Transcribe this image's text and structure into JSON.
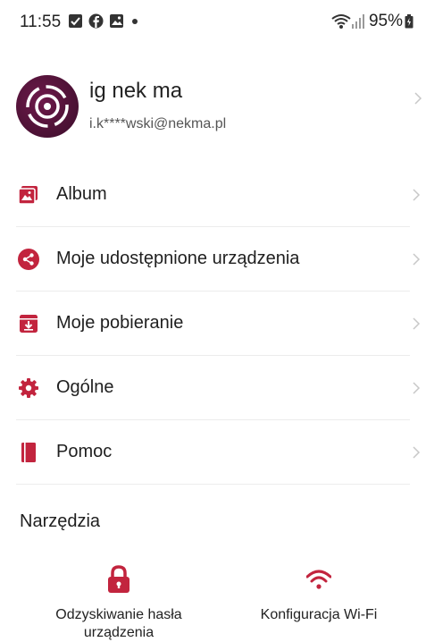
{
  "status_bar": {
    "time": "11:55",
    "battery": "95%"
  },
  "profile": {
    "name": "ig  nek ma",
    "email": "i.k****wski@nekma.pl"
  },
  "menu": [
    {
      "label": "Album",
      "icon": "album-icon"
    },
    {
      "label": "Moje udostępnione urządzenia",
      "icon": "share-icon"
    },
    {
      "label": "Moje pobieranie",
      "icon": "download-icon"
    },
    {
      "label": "Ogólne",
      "icon": "gear-icon"
    },
    {
      "label": "Pomoc",
      "icon": "book-icon"
    }
  ],
  "tools_section": {
    "title": "Narzędzia",
    "items": [
      {
        "label_line1": "Odzyskiwanie hasła",
        "label_line2": "urządzenia",
        "icon": "lock-icon"
      },
      {
        "label_line1": "Konfiguracja Wi-Fi",
        "label_line2": "",
        "icon": "wifi-icon"
      }
    ]
  },
  "colors": {
    "accent": "#c2243e",
    "avatar": "#5a1440",
    "divider": "#ececec"
  }
}
